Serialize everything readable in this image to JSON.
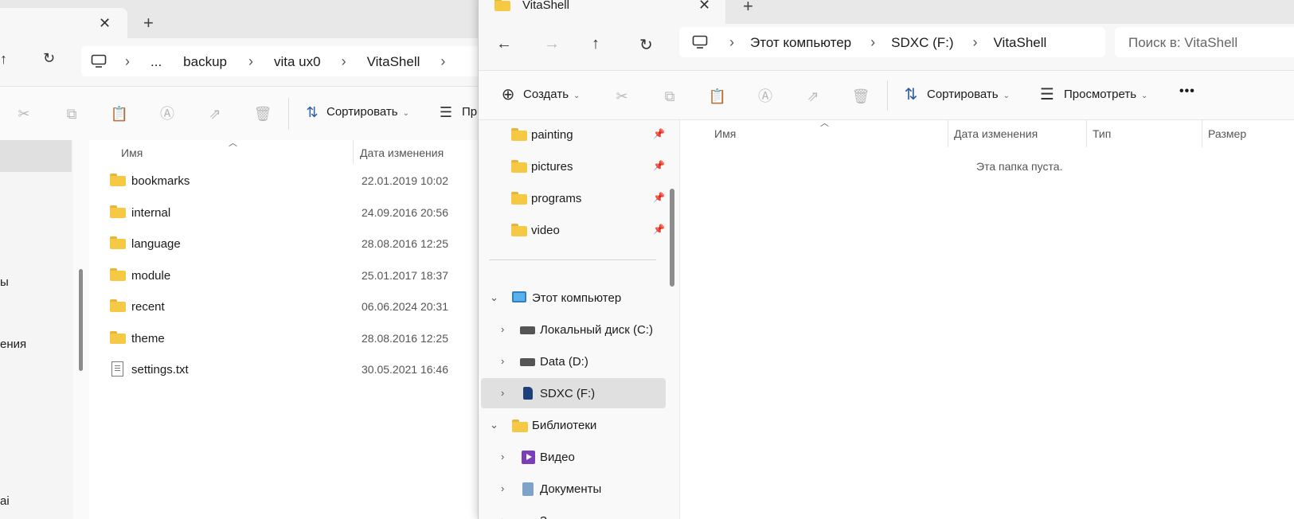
{
  "back_window": {
    "breadcrumbs": [
      "...",
      "backup",
      "vita ux0",
      "VitaShell"
    ],
    "toolbar": {
      "sort_label": "Сортировать",
      "view_label_partial": "Пр"
    },
    "sidebar_fragments": [
      "ы",
      "ения",
      "ai"
    ],
    "columns": {
      "name": "Имя",
      "date": "Дата изменения"
    },
    "files": [
      {
        "name": "bookmarks",
        "date": "22.01.2019 10:02",
        "type": "folder"
      },
      {
        "name": "internal",
        "date": "24.09.2016 20:56",
        "type": "folder"
      },
      {
        "name": "language",
        "date": "28.08.2016 12:25",
        "type": "folder"
      },
      {
        "name": "module",
        "date": "25.01.2017 18:37",
        "type": "folder"
      },
      {
        "name": "recent",
        "date": "06.06.2024 20:31",
        "type": "folder"
      },
      {
        "name": "theme",
        "date": "28.08.2016 12:25",
        "type": "folder"
      },
      {
        "name": "settings.txt",
        "date": "30.05.2021 16:46",
        "type": "text-file"
      }
    ]
  },
  "front_window": {
    "tab_title": "VitaShell",
    "breadcrumbs": [
      "Этот компьютер",
      "SDXC (F:)",
      "VitaShell"
    ],
    "search_placeholder": "Поиск в: VitaShell",
    "toolbar": {
      "create_label": "Создать",
      "sort_label": "Сортировать",
      "view_label": "Просмотреть",
      "more_label": "•••"
    },
    "quick_access": [
      {
        "name": "painting"
      },
      {
        "name": "pictures"
      },
      {
        "name": "programs"
      },
      {
        "name": "video"
      }
    ],
    "tree": {
      "this_pc": "Этот компьютер",
      "local_disk": "Локальный диск (C:)",
      "data_disk": "Data (D:)",
      "sdxc": "SDXC (F:)",
      "libraries": "Библиотеки",
      "videos": "Видео",
      "documents": "Документы",
      "next_partial": "З"
    },
    "columns": {
      "name": "Имя",
      "date": "Дата изменения",
      "type": "Тип",
      "size": "Размер"
    },
    "empty_message": "Эта папка пуста."
  },
  "colors": {
    "folder_yellow": "#f6c945",
    "selected_bg": "#e0e0e0",
    "monitor_blue": "#5ab2ec"
  }
}
